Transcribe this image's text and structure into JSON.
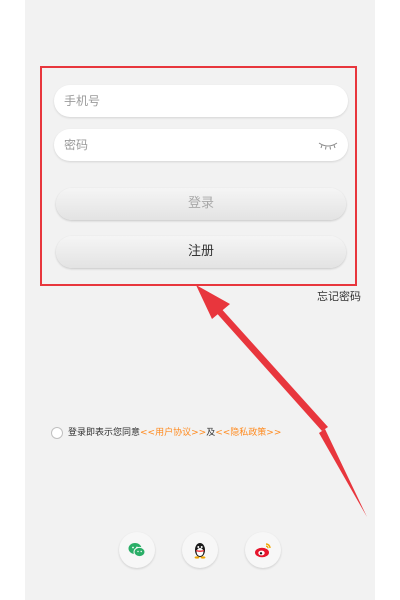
{
  "form": {
    "phone_placeholder": "手机号",
    "password_placeholder": "密码",
    "login_label": "登录",
    "register_label": "注册",
    "forgot_label": "忘记密码"
  },
  "agreement": {
    "prefix": "登录即表示您同意",
    "user_agreement": "<<用户协议>>",
    "and": "及",
    "privacy_policy": "<<隐私政策>>"
  },
  "social": {
    "icons": [
      "wechat-icon",
      "qq-icon",
      "weibo-icon"
    ]
  },
  "colors": {
    "highlight_border": "#e8363d",
    "arrow": "#e8363d",
    "link": "#ff8a1e"
  }
}
